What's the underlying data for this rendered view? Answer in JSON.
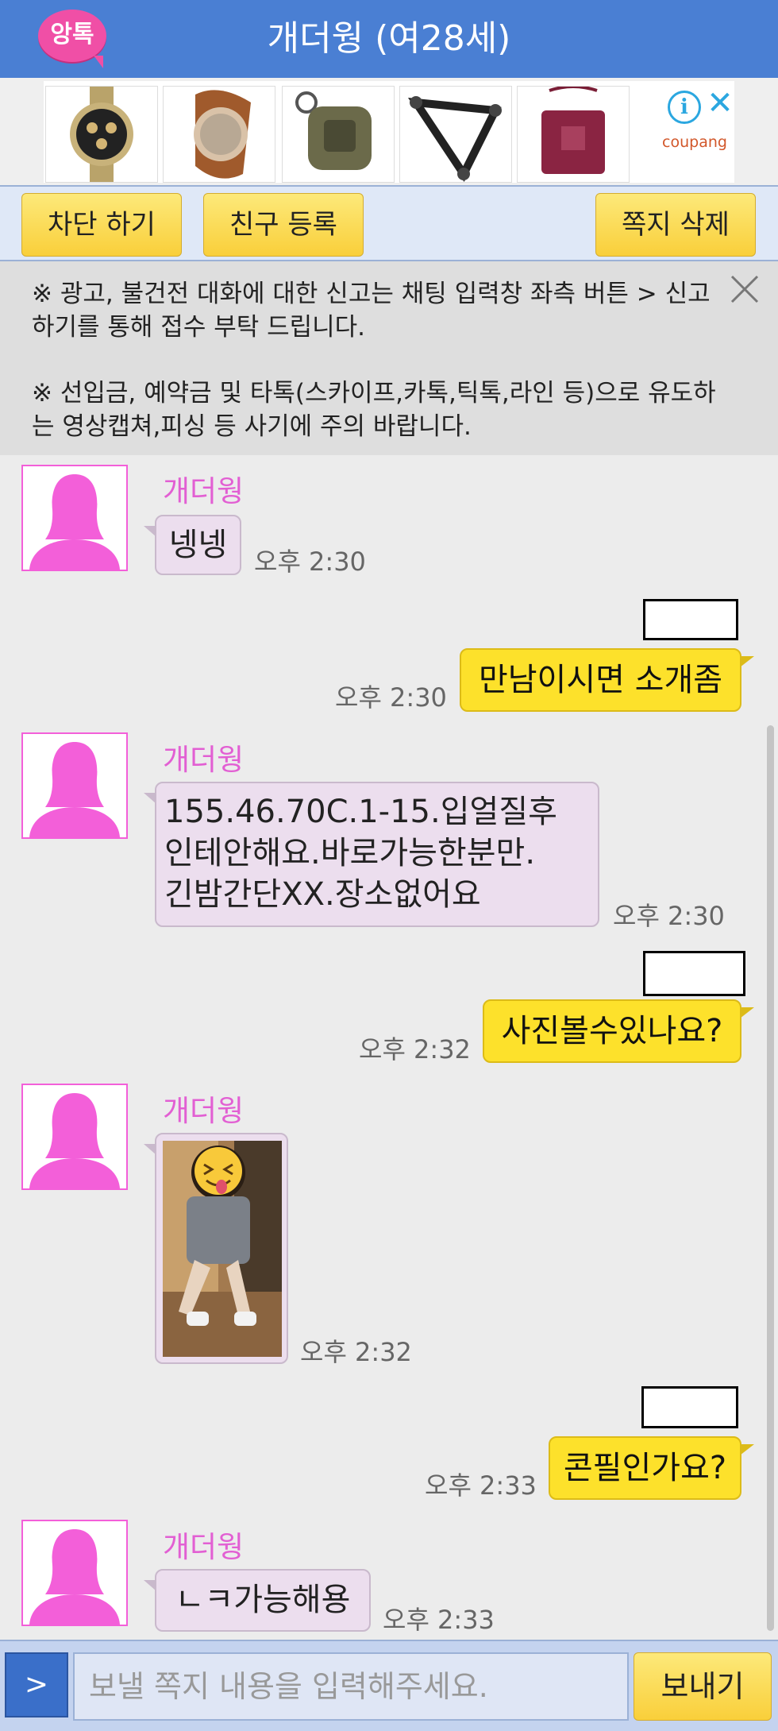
{
  "header": {
    "logo_text": "앙톡",
    "title": "개더웡 (여28세)",
    "color": "#4a7fd3"
  },
  "ad": {
    "info_icon": "info-icon",
    "close_icon": "close-icon",
    "brand": "coupang",
    "products": [
      "watch-gold",
      "smartwatch-brown",
      "case-olive",
      "tripod-black",
      "wallet-burgundy"
    ]
  },
  "toolbar": {
    "block_label": "차단 하기",
    "friend_label": "친구 등록",
    "delete_label": "쪽지 삭제"
  },
  "notice": {
    "line1": "※ 광고, 불건전 대화에 대한 신고는 채팅 입력창 좌측 버튼 > 신고하기를 통해 접수 부탁 드립니다.",
    "line2": "※ 선입금, 예약금 및 타톡(스카이프,카톡,틱톡,라인 등)으로 유도하는 영상캡쳐,피싱 등 사기에 주의 바랍니다."
  },
  "messages": [
    {
      "from": "them",
      "sender": "개더웡",
      "text": "넹넹",
      "time": "오후 2:30"
    },
    {
      "from": "me",
      "text": "만남이시면 소개좀",
      "time": "오후 2:30"
    },
    {
      "from": "them",
      "sender": "개더웡",
      "text": "155.46.70C.1-15.입얼질후 인테안해요.바로가능한분만. 긴밤간단XX.장소없어요",
      "lines": [
        "155.46.70C.1-15.입얼질후",
        "인테안해요.바로가능한분만.",
        "긴밤간단XX.장소없어요"
      ],
      "time": "오후 2:30"
    },
    {
      "from": "me",
      "text": "사진볼수있나요?",
      "time": "오후 2:32"
    },
    {
      "from": "them",
      "sender": "개더웡",
      "image": "photo",
      "time": "오후 2:32"
    },
    {
      "from": "me",
      "text": "콘필인가요?",
      "time": "오후 2:33"
    },
    {
      "from": "them",
      "sender": "개더웡",
      "text": "ㄴㅋ가능해용",
      "time": "오후 2:33"
    }
  ],
  "input": {
    "toggle_label": ">",
    "placeholder": "보낼 쪽지 내용을 입력해주세요.",
    "send_label": "보내기"
  }
}
